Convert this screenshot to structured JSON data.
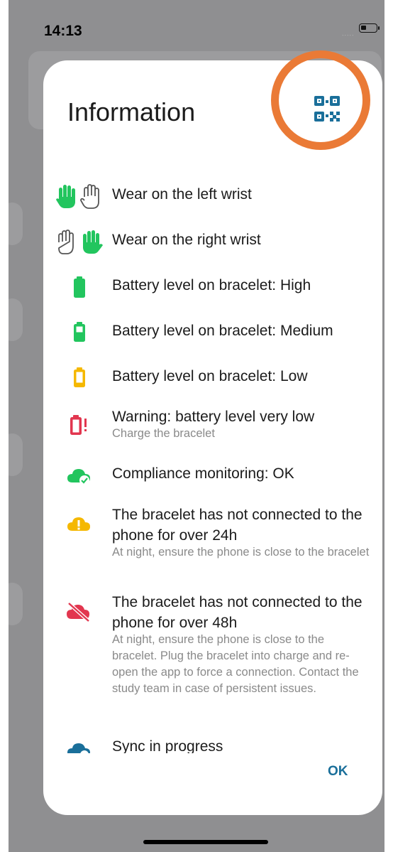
{
  "status_bar": {
    "time": "14:13",
    "signal_dots": "....."
  },
  "dialog": {
    "title": "Information",
    "qr_icon": "qr-code-icon",
    "ok_label": "OK",
    "items": [
      {
        "icon": "left-wrist-hands-icon",
        "title": "Wear on the left wrist",
        "subtitle": ""
      },
      {
        "icon": "right-wrist-hands-icon",
        "title": "Wear on the right wrist",
        "subtitle": ""
      },
      {
        "icon": "battery-high-icon",
        "title": "Battery level on bracelet: High",
        "subtitle": ""
      },
      {
        "icon": "battery-medium-icon",
        "title": "Battery level on bracelet: Medium",
        "subtitle": ""
      },
      {
        "icon": "battery-low-icon",
        "title": "Battery level on bracelet: Low",
        "subtitle": ""
      },
      {
        "icon": "battery-alert-icon",
        "title": "Warning: battery level very low",
        "subtitle": "Charge the bracelet"
      },
      {
        "icon": "cloud-check-icon",
        "title": "Compliance monitoring: OK",
        "subtitle": ""
      },
      {
        "icon": "cloud-warning-icon",
        "title": "The bracelet has not connected to the phone for over 24h",
        "subtitle": "At night, ensure the phone is close to the bracelet"
      },
      {
        "icon": "cloud-off-icon",
        "title": "The bracelet has not connected to the phone for over 48h",
        "subtitle": "At night, ensure the phone is close to the bracelet. Plug the bracelet into charge and re-open the app to force a connection. Contact the study team in case of persistent issues."
      },
      {
        "icon": "cloud-sync-icon",
        "title": "Sync in progress",
        "subtitle": ""
      }
    ]
  },
  "colors": {
    "green": "#22c55e",
    "yellow": "#f5b800",
    "red": "#e2364f",
    "blue": "#1a6f9a",
    "annotation_orange": "#ea7a36"
  }
}
